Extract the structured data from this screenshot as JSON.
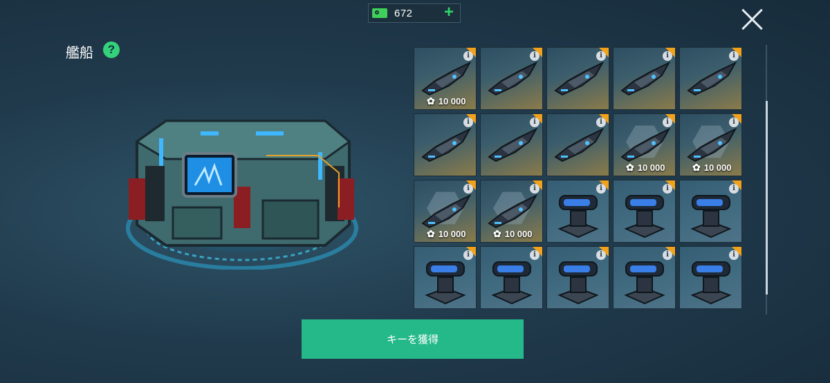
{
  "currency": {
    "amount": "672",
    "icon": "key-icon"
  },
  "section": {
    "title": "艦船",
    "help_label": "?"
  },
  "items": [
    {
      "type": "ship",
      "price": "10 000"
    },
    {
      "type": "ship"
    },
    {
      "type": "ship"
    },
    {
      "type": "ship"
    },
    {
      "type": "ship"
    },
    {
      "type": "ship"
    },
    {
      "type": "ship"
    },
    {
      "type": "ship"
    },
    {
      "type": "ship",
      "price": "10 000"
    },
    {
      "type": "ship",
      "price": "10 000"
    },
    {
      "type": "ship",
      "price": "10 000"
    },
    {
      "type": "ship",
      "price": "10 000"
    },
    {
      "type": "turret"
    },
    {
      "type": "turret"
    },
    {
      "type": "turret"
    },
    {
      "type": "turret"
    },
    {
      "type": "turret"
    },
    {
      "type": "turret"
    },
    {
      "type": "turret"
    },
    {
      "type": "turret"
    }
  ],
  "info_label": "i",
  "button": {
    "label": "キーを獲得"
  },
  "colors": {
    "accent": "#25b98a",
    "corner": "#f1a21c",
    "key": "#3fcf5a"
  }
}
